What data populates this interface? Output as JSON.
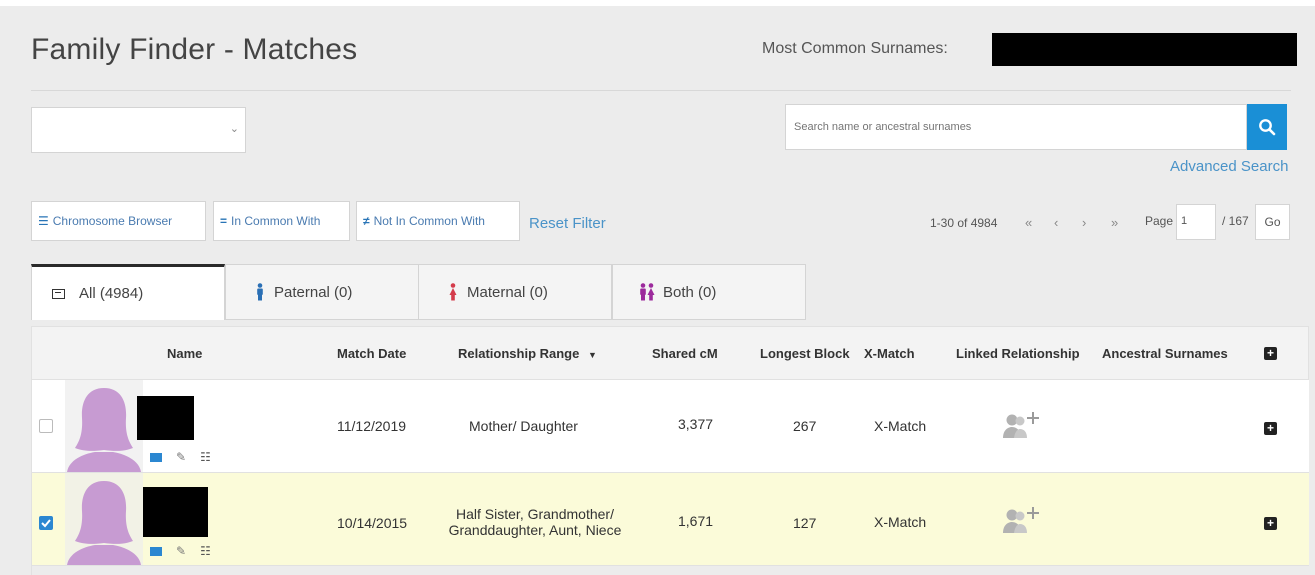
{
  "header": {
    "title": "Family Finder - Matches",
    "surnames_label": "Most Common Surnames:"
  },
  "filters": {
    "select_value": "",
    "search_placeholder": "Search name or ancestral surnames",
    "advanced_search": "Advanced Search"
  },
  "toolbar": {
    "chromosome_browser": "Chromosome Browser",
    "in_common_with": "In Common With",
    "not_in_common_with": "Not In Common With",
    "reset_filter": "Reset Filter"
  },
  "pagination": {
    "range": "1-30 of 4984",
    "first": "«",
    "prev": "‹",
    "next": "›",
    "last": "»",
    "page_label": "Page",
    "page_value": "1",
    "total": "/ 167",
    "go": "Go"
  },
  "tabs": [
    {
      "label": "All (4984)",
      "active": true
    },
    {
      "label": "Paternal (0)",
      "color": "#2a6fb5"
    },
    {
      "label": "Maternal (0)",
      "color": "#d43b4b"
    },
    {
      "label": "Both (0)",
      "color": "#9c2a9c"
    }
  ],
  "table": {
    "columns": [
      "Name",
      "Match Date",
      "Relationship Range",
      "Shared cM",
      "Longest Block",
      "X-Match",
      "Linked Relationship",
      "Ancestral Surnames"
    ],
    "rows": [
      {
        "checked": false,
        "match_date": "11/12/2019",
        "relationship": "Mother/ Daughter",
        "shared_cm": "3,377",
        "longest_block": "267",
        "x_match": "X-Match"
      },
      {
        "checked": true,
        "match_date": "10/14/2015",
        "relationship_line1": "Half Sister, Grandmother/",
        "relationship_line2": "Granddaughter, Aunt, Niece",
        "shared_cm": "1,671",
        "longest_block": "127",
        "x_match": "X-Match"
      }
    ]
  },
  "colors": {
    "accent": "#1a8fd6",
    "link": "#4a93c8",
    "avatar": "#c79bd2",
    "selected_row": "#fbfbd9"
  }
}
